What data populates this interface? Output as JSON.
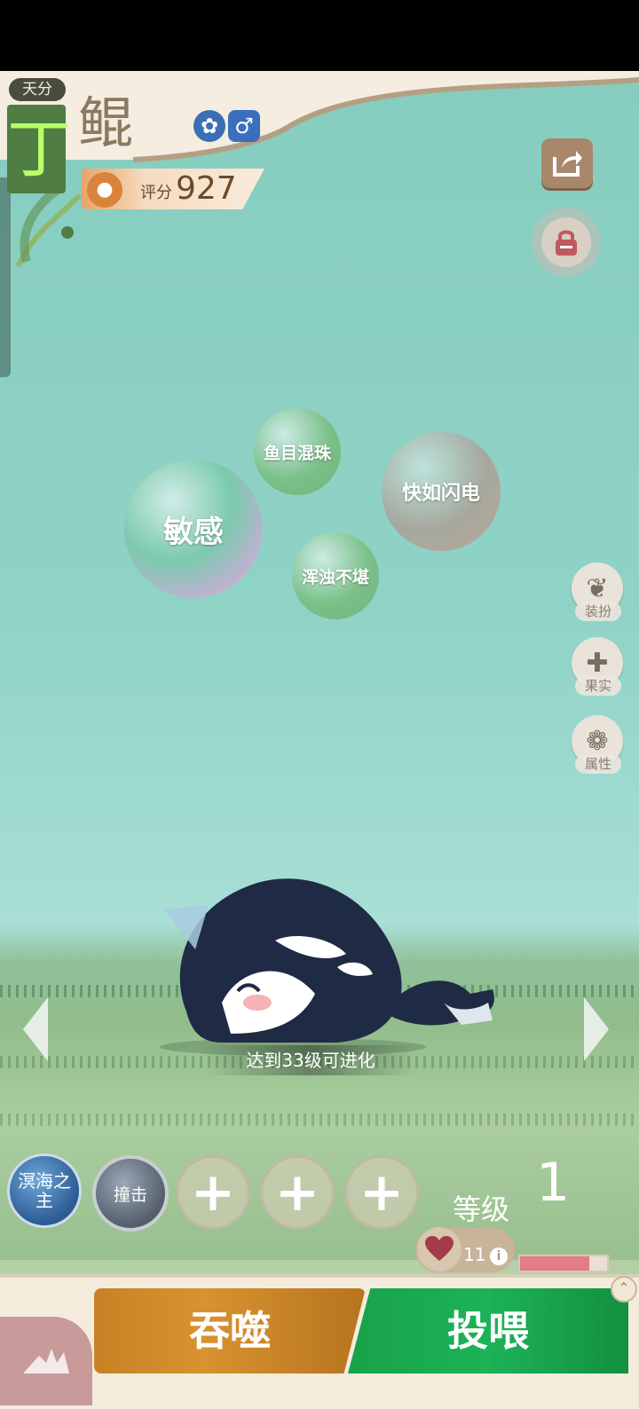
{
  "talent": {
    "label": "天分",
    "grade": "丁"
  },
  "pet": {
    "name": "鲲",
    "score_label": "评分",
    "score": "927",
    "evolve_tip": "达到33级可进化",
    "level_label": "等级",
    "level": "1"
  },
  "traits": [
    "敏感",
    "鱼目混珠",
    "快如闪电",
    "浑浊不堪"
  ],
  "side_menu": [
    {
      "label": "装扮",
      "icon": "butterfly-icon"
    },
    {
      "label": "果实",
      "icon": "plus-icon"
    },
    {
      "label": "属性",
      "icon": "paw-icon"
    }
  ],
  "skills": {
    "main": "溟海之主",
    "second": "撞击",
    "empty_symbol": "+"
  },
  "affection": {
    "count": "11",
    "info": "i",
    "fill_fraction": 0.8
  },
  "actions": {
    "devour": "吞噬",
    "feed": "投喂"
  },
  "colors": {
    "devour": "#d08a2a",
    "feed": "#1aa84f",
    "grade": "#b8ff6a"
  }
}
